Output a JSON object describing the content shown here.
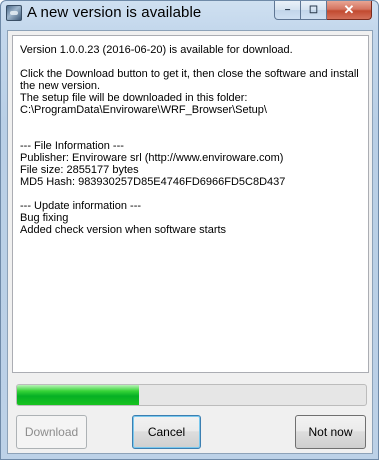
{
  "window": {
    "title": "A new version is available"
  },
  "caption": {
    "minimize": "−",
    "maximize": "☐",
    "close": "✕"
  },
  "message_lines": [
    "Version 1.0.0.23 (2016-06-20) is available for download.",
    "",
    "Click the Download button to get it, then close the software and install",
    "the new version.",
    "The setup file will be downloaded in this folder:",
    "C:\\ProgramData\\Enviroware\\WRF_Browser\\Setup\\",
    "",
    "",
    "--- File Information ---",
    "Publisher: Enviroware srl (http://www.enviroware.com)",
    "File size: 2855177 bytes",
    "MD5 Hash: 983930257D85E4746FD6966FD5C8D437",
    "",
    "--- Update information ---",
    "Bug fixing",
    "Added check version when software starts"
  ],
  "progress": {
    "fraction": 0.35,
    "fill_color": "#06b025"
  },
  "buttons": {
    "download": "Download",
    "cancel": "Cancel",
    "not_now": "Not now"
  }
}
